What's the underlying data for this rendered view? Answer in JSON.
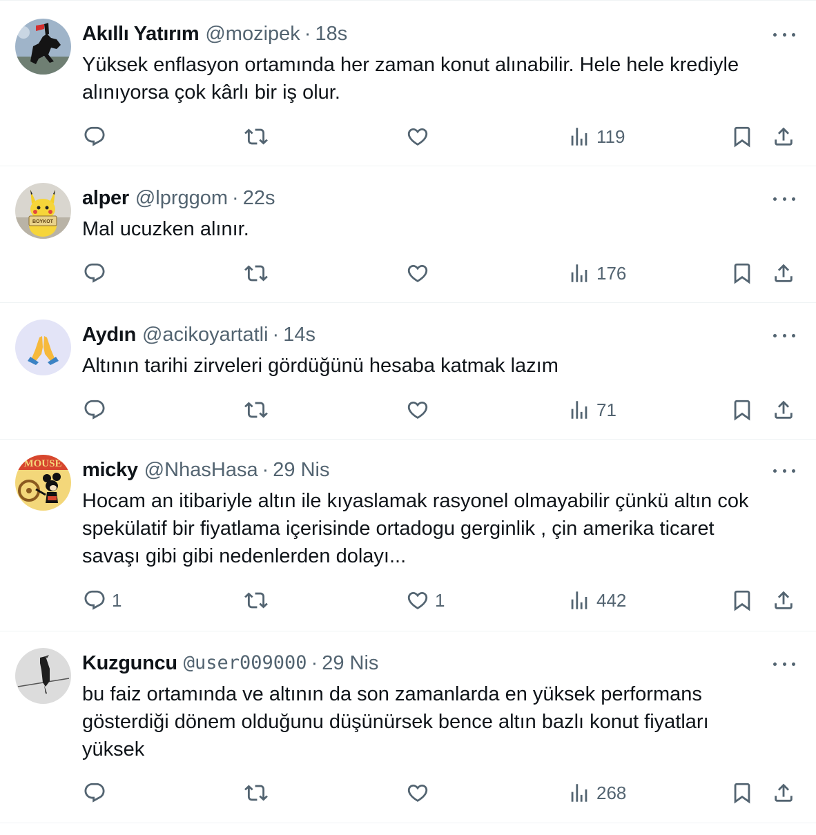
{
  "tweets": [
    {
      "name": "Akıllı Yatırım",
      "handle": "@mozipek",
      "separator": "·",
      "time": "18s",
      "text_lines": [
        "Yüksek enflasyon ortamında her zaman konut alınabilir. Hele hele krediyle",
        "alınıyorsa çok kârlı bir iş olur."
      ],
      "replies": "",
      "retweets": "",
      "likes": "",
      "views": "119",
      "avatar": "horse-statue-avatar"
    },
    {
      "name": "alper",
      "handle": "@lprggom",
      "separator": "·",
      "time": "22s",
      "text_lines": [
        "Mal ucuzken alınır."
      ],
      "replies": "",
      "retweets": "",
      "likes": "",
      "views": "176",
      "avatar": "pikachu-boykot-avatar",
      "avatar_sign": "BOYKOT"
    },
    {
      "name": "Aydın",
      "handle": "@acikoyartatli",
      "separator": "·",
      "time": "14s",
      "text_lines": [
        "Altının tarihi zirveleri gördüğünü hesaba katmak lazım"
      ],
      "replies": "",
      "retweets": "",
      "likes": "",
      "views": "71",
      "avatar": "praying-hands-avatar"
    },
    {
      "name": "micky",
      "handle": "@NhasHasa",
      "separator": "·",
      "time": "29 Nis",
      "text_lines": [
        "Hocam an itibariyle altın ile kıyaslamak rasyonel olmayabilir çünkü altın cok",
        "spekülatif bir fiyatlama içerisinde ortadogu gerginlik , çin amerika ticaret",
        "savaşı gibi gibi nedenlerden dolayı..."
      ],
      "replies": "1",
      "retweets": "",
      "likes": "1",
      "views": "442",
      "avatar": "mickey-mouse-avatar",
      "avatar_sign": "MOUSE"
    },
    {
      "name": "Kuzguncu",
      "handle": "@user009000",
      "separator": "·",
      "time": "29 Nis",
      "text_lines": [
        "bu faiz ortamında ve altının da son zamanlarda en yüksek performans",
        "gösterdiği dönem olduğunu düşünürsek bence altın bazlı konut fiyatları",
        "yüksek"
      ],
      "replies": "",
      "retweets": "",
      "likes": "",
      "views": "268",
      "avatar": "crow-on-wire-avatar"
    }
  ],
  "icons": {
    "reply": "reply-icon",
    "retweet": "retweet-icon",
    "like": "heart-icon",
    "views": "views-icon",
    "bookmark": "bookmark-icon",
    "share": "share-icon",
    "more": "more-icon"
  },
  "colors": {
    "text": "#0f1419",
    "secondary": "#536471",
    "divider": "#eff3f4"
  }
}
